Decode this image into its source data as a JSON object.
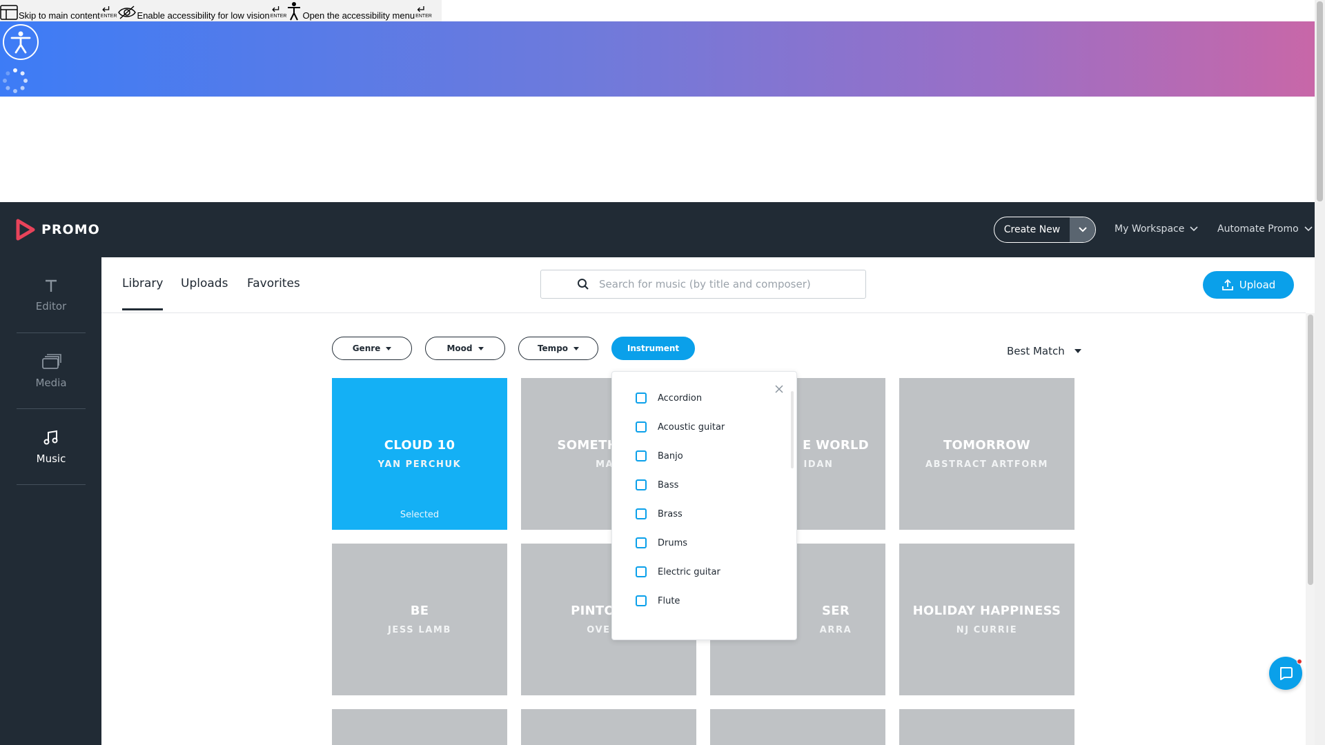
{
  "skip_links": [
    {
      "icon": "layout-icon",
      "label": "Skip to main content",
      "key": "ENTER"
    },
    {
      "icon": "eye-slash-icon",
      "label": "Enable accessibility for low vision",
      "key": "ENTER"
    },
    {
      "icon": "accessibility-person-icon",
      "label": "Open the accessibility menu",
      "key": "ENTER"
    }
  ],
  "header": {
    "logo_text": "PROMO",
    "create_new_label": "Create New",
    "my_workspace_label": "My Workspace",
    "automate_promo_label": "Automate Promo"
  },
  "sidebar": {
    "items": [
      {
        "label": "Editor",
        "icon": "text-t-icon"
      },
      {
        "label": "Media",
        "icon": "media-stack-icon"
      },
      {
        "label": "Music",
        "icon": "music-note-icon"
      }
    ],
    "active": "Music"
  },
  "tabs": [
    {
      "label": "Library",
      "active": true
    },
    {
      "label": "Uploads",
      "active": false
    },
    {
      "label": "Favorites",
      "active": false
    }
  ],
  "search": {
    "placeholder": "Search for music (by title and composer)",
    "value": ""
  },
  "upload_label": "Upload",
  "filters": [
    {
      "label": "Genre",
      "active": false
    },
    {
      "label": "Mood",
      "active": false
    },
    {
      "label": "Tempo",
      "active": false
    },
    {
      "label": "Instrument",
      "active": true
    }
  ],
  "sort": {
    "label": "Best Match"
  },
  "cards": [
    {
      "title": "CLOUD 10",
      "artist": "YAN PERCHUK",
      "status": "Selected",
      "selected": true
    },
    {
      "title": "SOMETHING",
      "artist": "MAK",
      "status": "",
      "selected": false
    },
    {
      "title": "E WORLD",
      "artist": "IDAN",
      "status": "",
      "selected": false
    },
    {
      "title": "TOMORROW",
      "artist": "ABSTRACT ARTFORM",
      "status": "",
      "selected": false
    },
    {
      "title": "BE",
      "artist": "JESS LAMB",
      "status": "",
      "selected": false
    },
    {
      "title": "PINTO'S R",
      "artist": "OVE S",
      "status": "",
      "selected": false
    },
    {
      "title": "SER",
      "artist": "ARRA",
      "status": "",
      "selected": false
    },
    {
      "title": "HOLIDAY HAPPINESS",
      "artist": "NJ CURRIE",
      "status": "",
      "selected": false
    }
  ],
  "instrument_dropdown": {
    "options": [
      "Accordion",
      "Acoustic guitar",
      "Banjo",
      "Bass",
      "Brass",
      "Drums",
      "Electric guitar",
      "Flute"
    ]
  },
  "colors": {
    "accent": "#0aa0ea",
    "dark": "#212b35",
    "card_gray": "#bfc2c5",
    "selected_card": "#14b0f5",
    "logo_red": "#e8435a"
  }
}
